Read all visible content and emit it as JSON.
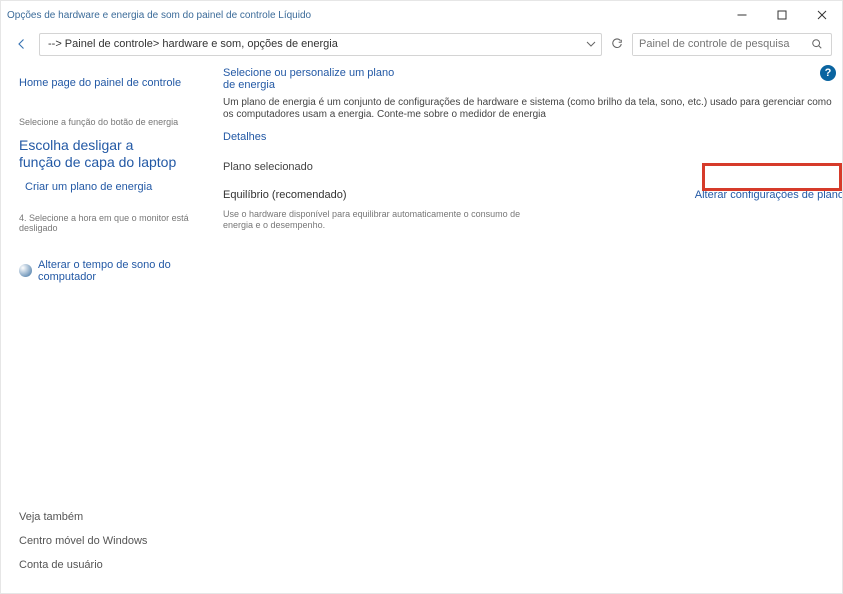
{
  "window": {
    "title": "Opções de hardware e energia de som do painel de controle Líquido"
  },
  "nav": {
    "breadcrumb": "--> Painel de controle> hardware e som, opções de energia",
    "search_placeholder": "Painel de controle de pesquisa"
  },
  "sidebar": {
    "home": "Home page do painel de controle",
    "power_btn_label": "Selecione a função do botão de energia",
    "close_lid": "Escolha desligar a função de capa do laptop",
    "create_plan": "Criar um plano de energia",
    "monitor_off": "4. Selecione a hora em que o monitor está desligado",
    "sleep": "Alterar o tempo de sono do computador",
    "see_also_heading": "Veja também",
    "mobility_center": "Centro móvel do Windows",
    "user_account": "Conta de usuário"
  },
  "main": {
    "heading": "Selecione ou personalize um plano de energia",
    "description": "Um plano de energia é um conjunto de configurações de hardware e sistema (como brilho da tela, sono, etc.) usado para gerenciar como os computadores usam a energia. Conte-me sobre o medidor de energia",
    "details": "Detalhes",
    "selected_plan_label": "Plano selecionado",
    "plan_name": "Equilíbrio (recomendado)",
    "plan_desc": "Use o hardware disponível para equilibrar automaticamente o consumo de energia e o desempenho.",
    "change_settings": "Alterar configurações de plano"
  }
}
